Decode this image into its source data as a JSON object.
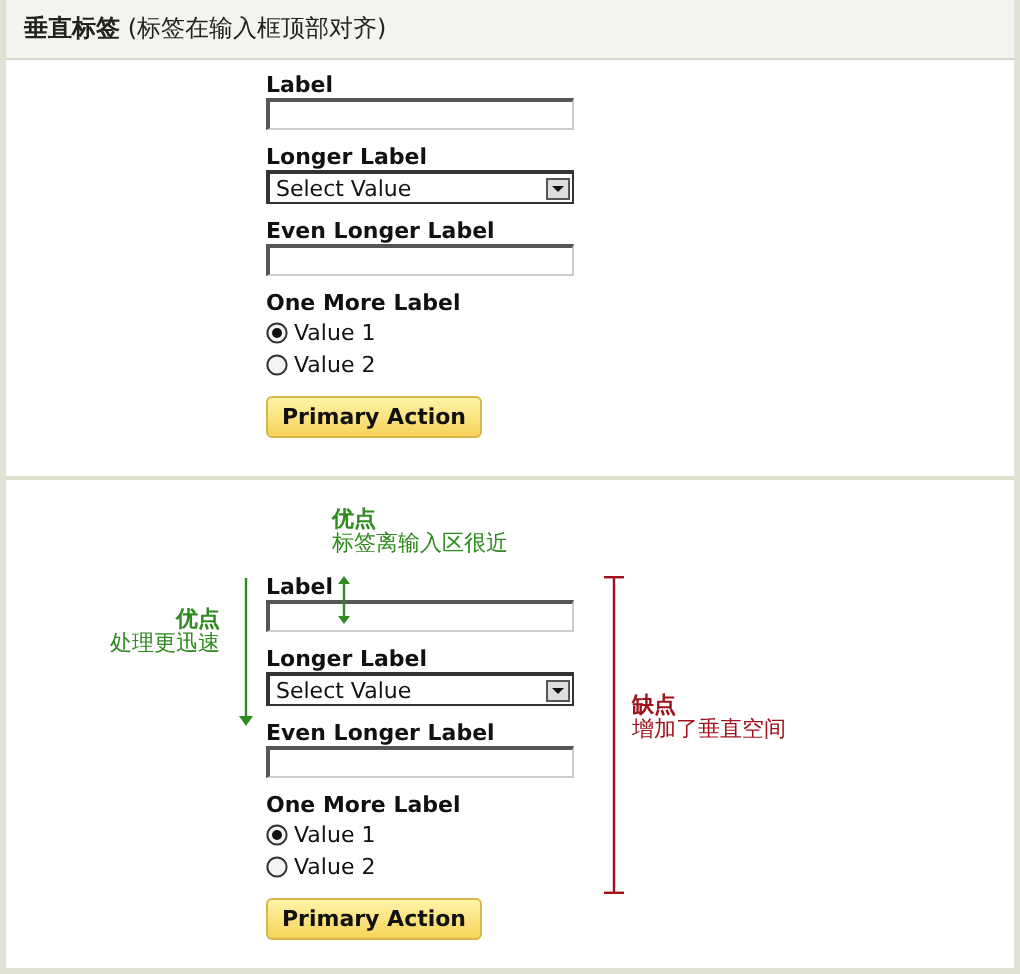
{
  "header": {
    "title": "**垂直标签** (标签在输入框顶部对齐)"
  },
  "forms": [
    {
      "fields": [
        {
          "kind": "text",
          "label": "Label"
        },
        {
          "kind": "select",
          "label": "Longer Label",
          "value": "Select Value"
        },
        {
          "kind": "text",
          "label": "Even Longer Label"
        },
        {
          "kind": "radio",
          "label": "One More Label",
          "options": [
            {
              "label": "Value 1",
              "selected": true
            },
            {
              "label": "Value 2",
              "selected": false
            }
          ]
        }
      ],
      "button": "Primary Action"
    },
    {
      "fields": [
        {
          "kind": "text",
          "label": "Label"
        },
        {
          "kind": "select",
          "label": "Longer Label",
          "value": "Select Value"
        },
        {
          "kind": "text",
          "label": "Even Longer Label"
        },
        {
          "kind": "radio",
          "label": "One More Label",
          "options": [
            {
              "label": "Value 1",
              "selected": true
            },
            {
              "label": "Value 2",
              "selected": false
            }
          ]
        }
      ],
      "button": "Primary Action",
      "annotations": [
        {
          "kind": "top",
          "color": "#2e8b1e",
          "heading": "优点",
          "text": "标签离输入区很近"
        },
        {
          "kind": "left",
          "color": "#2e8b1e",
          "heading": "优点",
          "text": "处理更迅速"
        },
        {
          "kind": "right",
          "color": "#a0101c",
          "heading": "缺点",
          "text": "增加了垂直空间"
        }
      ]
    }
  ]
}
